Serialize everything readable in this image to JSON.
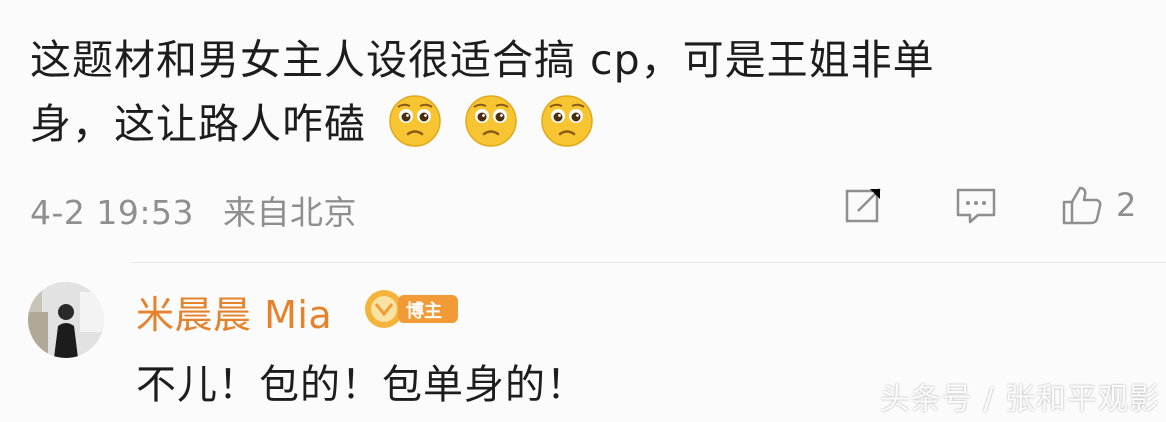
{
  "comment": {
    "line1": "这题材和男女主人设很适合搞 cp，可是王姐非单",
    "line2": "身，这让路人咋磕",
    "emojis": [
      "pleading-face-icon",
      "pleading-face-icon",
      "pleading-face-icon"
    ],
    "timestamp": "4-2 19:53",
    "location": "来自北京",
    "like_count": "2"
  },
  "reply": {
    "name": "米晨晨 Mia",
    "badge": "博主",
    "text": "不儿！包的！包单身的！"
  },
  "watermark": "头条号 / 张和平观影",
  "colors": {
    "name": "#e5832c",
    "badge": "#f29a36",
    "text": "#1d1d1d",
    "meta": "#8f8f8f"
  }
}
